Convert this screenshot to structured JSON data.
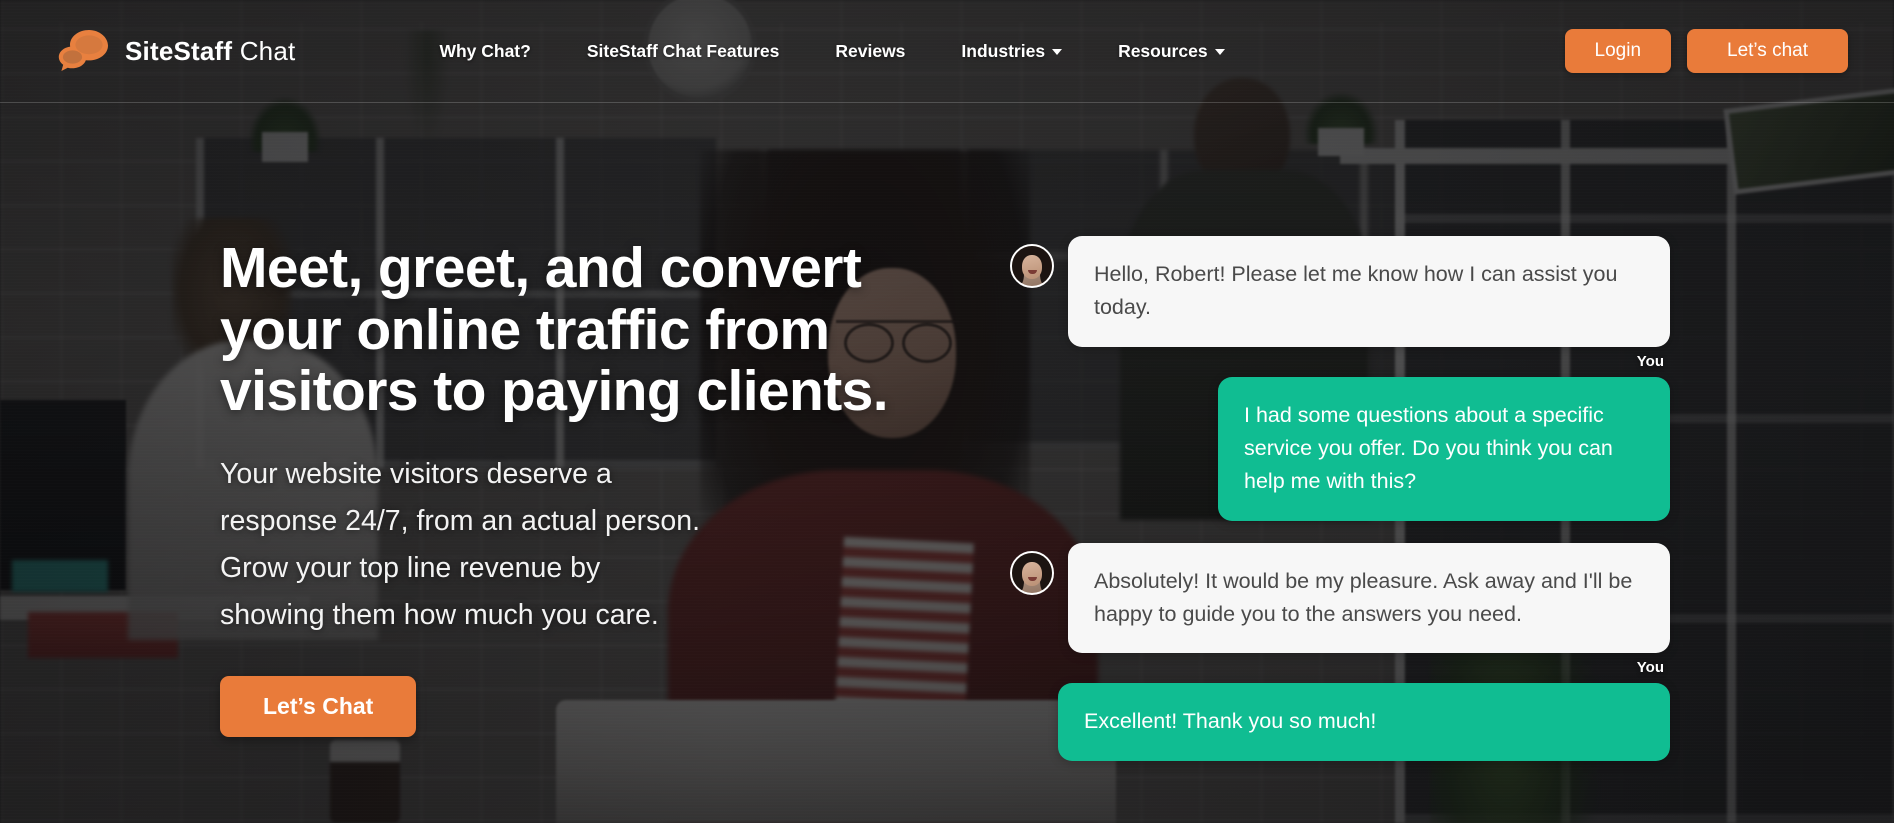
{
  "brand": {
    "name_bold": "SiteStaff",
    "name_thin": "Chat",
    "logo_icon": "chat-bubbles-icon",
    "accent_color": "#e97b3a"
  },
  "nav": {
    "links": [
      {
        "label": "Why Chat?",
        "has_dropdown": false
      },
      {
        "label": "SiteStaff Chat Features",
        "has_dropdown": false
      },
      {
        "label": "Reviews",
        "has_dropdown": false
      },
      {
        "label": "Industries",
        "has_dropdown": true
      },
      {
        "label": "Resources",
        "has_dropdown": true
      }
    ],
    "login_label": "Login",
    "cta_label": "Let’s chat"
  },
  "hero": {
    "headline_lines": [
      "Meet, greet, and convert",
      "your online traffic from",
      "visitors to paying clients."
    ],
    "subhead_lines": [
      "Your website visitors deserve a",
      "response 24/7, from an actual person.",
      " Grow your top line revenue by",
      "showing them how much you care."
    ],
    "cta_label": "Let’s Chat"
  },
  "chat": {
    "you_label": "You",
    "agent_avatar": "agent-avatar",
    "agent_bubble_color": "#f7f7f7",
    "user_bubble_color": "#10bd92",
    "messages": [
      {
        "sender": "agent",
        "text": "Hello, Robert! Please let me know how I can assist you today."
      },
      {
        "sender": "user",
        "text": "I had some questions about a specific service you offer. Do you think you can help me with this?"
      },
      {
        "sender": "agent",
        "text": "Absolutely! It would be my pleasure. Ask away and I'll be happy to guide you to the answers you need."
      },
      {
        "sender": "user",
        "text": "Excellent! Thank you so much!"
      }
    ]
  }
}
